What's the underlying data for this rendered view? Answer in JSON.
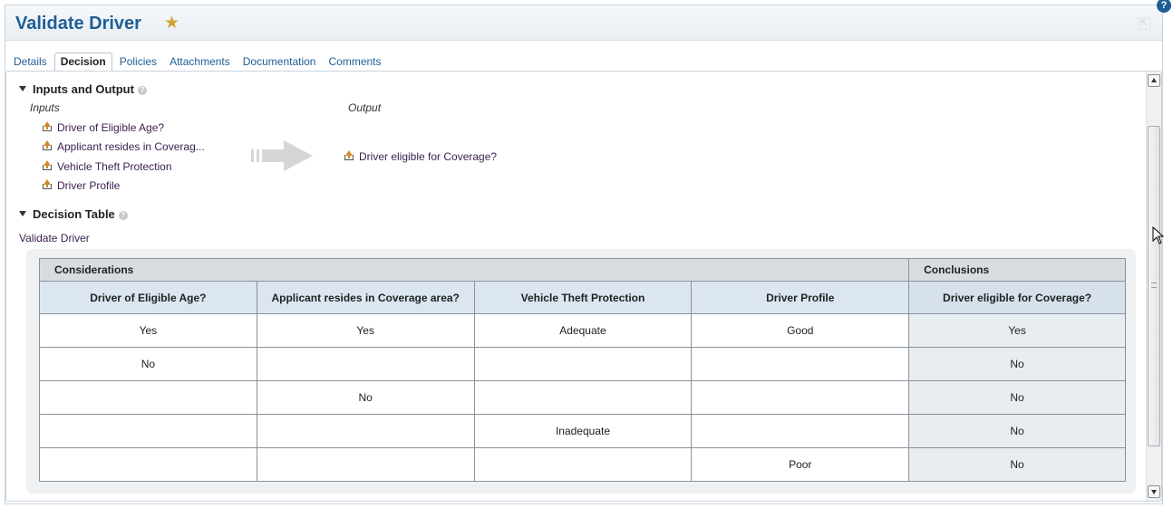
{
  "header": {
    "title": "Validate Driver",
    "star_icon": "star-icon",
    "expand_icon": "expand-icon"
  },
  "tabs": [
    {
      "label": "Details"
    },
    {
      "label": "Decision",
      "active": true
    },
    {
      "label": "Policies"
    },
    {
      "label": "Attachments"
    },
    {
      "label": "Documentation"
    },
    {
      "label": "Comments"
    }
  ],
  "inputs_output": {
    "section_title": "Inputs and Output",
    "inputs_label": "Inputs",
    "output_label": "Output",
    "inputs": [
      "Driver of Eligible Age?",
      "Applicant resides in Coverag...",
      "Vehicle Theft Protection",
      "Driver Profile"
    ],
    "output": "Driver eligible for Coverage?"
  },
  "decision_table": {
    "section_title": "Decision Table",
    "name": "Validate Driver",
    "groups": {
      "considerations": "Considerations",
      "conclusions": "Conclusions"
    },
    "columns": [
      "Driver of Eligible Age?",
      "Applicant resides in Coverage area?",
      "Vehicle Theft Protection",
      "Driver Profile",
      "Driver eligible for Coverage?"
    ],
    "rows": [
      [
        "Yes",
        "Yes",
        "Adequate",
        "Good",
        "Yes"
      ],
      [
        "No",
        "",
        "",
        "",
        "No"
      ],
      [
        "",
        "No",
        "",
        "",
        "No"
      ],
      [
        "",
        "",
        "Inadequate",
        "",
        "No"
      ],
      [
        "",
        "",
        "",
        "Poor",
        "No"
      ]
    ]
  },
  "colors": {
    "title": "#1f5e95",
    "link": "#1f5e95",
    "header_fill": "#dbe6f0",
    "conclusion_fill": "#e8edf2"
  }
}
